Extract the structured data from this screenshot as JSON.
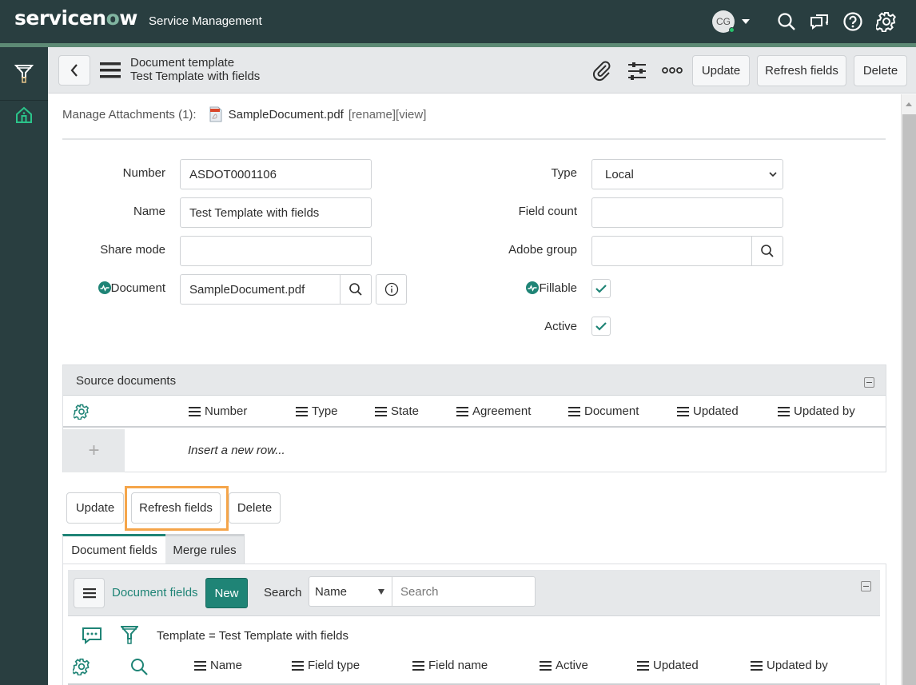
{
  "topbar": {
    "logo_prefix": "servicen",
    "logo_o": "o",
    "logo_suffix": "w",
    "product": "Service Management",
    "user_initials": "CG",
    "icons": [
      "search-icon",
      "chat-icon",
      "help-icon",
      "settings-icon"
    ]
  },
  "rail": {
    "items": [
      {
        "name": "filter-navigator",
        "icon": "funnel-icon"
      },
      {
        "name": "home",
        "icon": "home-icon"
      }
    ]
  },
  "header": {
    "table_label": "Document template",
    "record_name": "Test Template with fields",
    "buttons": {
      "update": "Update",
      "refresh": "Refresh fields",
      "delete": "Delete"
    }
  },
  "attachments": {
    "label": "Manage Attachments (1):",
    "file": "SampleDocument.pdf",
    "links": "[rename][view]"
  },
  "form": {
    "left": [
      {
        "label": "Number",
        "value": "ASDOT0001106"
      },
      {
        "label": "Name",
        "value": "Test Template with fields"
      },
      {
        "label": "Share mode",
        "value": ""
      },
      {
        "label": "Document",
        "value": "SampleDocument.pdf",
        "mandatory_indicator": true
      }
    ],
    "right": {
      "type": {
        "label": "Type",
        "value": "Local"
      },
      "field_count": {
        "label": "Field count",
        "value": ""
      },
      "adobe_group": {
        "label": "Adobe group",
        "value": ""
      },
      "fillable": {
        "label": "Fillable",
        "checked": true,
        "mandatory_indicator": true
      },
      "active": {
        "label": "Active",
        "checked": true
      }
    }
  },
  "source_documents": {
    "title": "Source documents",
    "columns": [
      "Number",
      "Type",
      "State",
      "Agreement",
      "Document",
      "Updated",
      "Updated by"
    ],
    "insert_row": "Insert a new row..."
  },
  "bottom_buttons": {
    "update": "Update",
    "refresh": "Refresh fields",
    "delete": "Delete"
  },
  "tabs": [
    {
      "label": "Document fields",
      "active": true
    },
    {
      "label": "Merge rules",
      "active": false
    }
  ],
  "document_fields": {
    "title": "Document fields",
    "new_label": "New",
    "search_label": "Search",
    "search_field": "Name",
    "search_placeholder": "Search",
    "filter": "Template = Test Template with fields",
    "columns": [
      "Name",
      "Field type",
      "Field name",
      "Active",
      "Updated",
      "Updated by"
    ]
  },
  "colors": {
    "header_bg": "#293e40",
    "accent": "#1f8476",
    "highlight": "#f5a54a"
  }
}
